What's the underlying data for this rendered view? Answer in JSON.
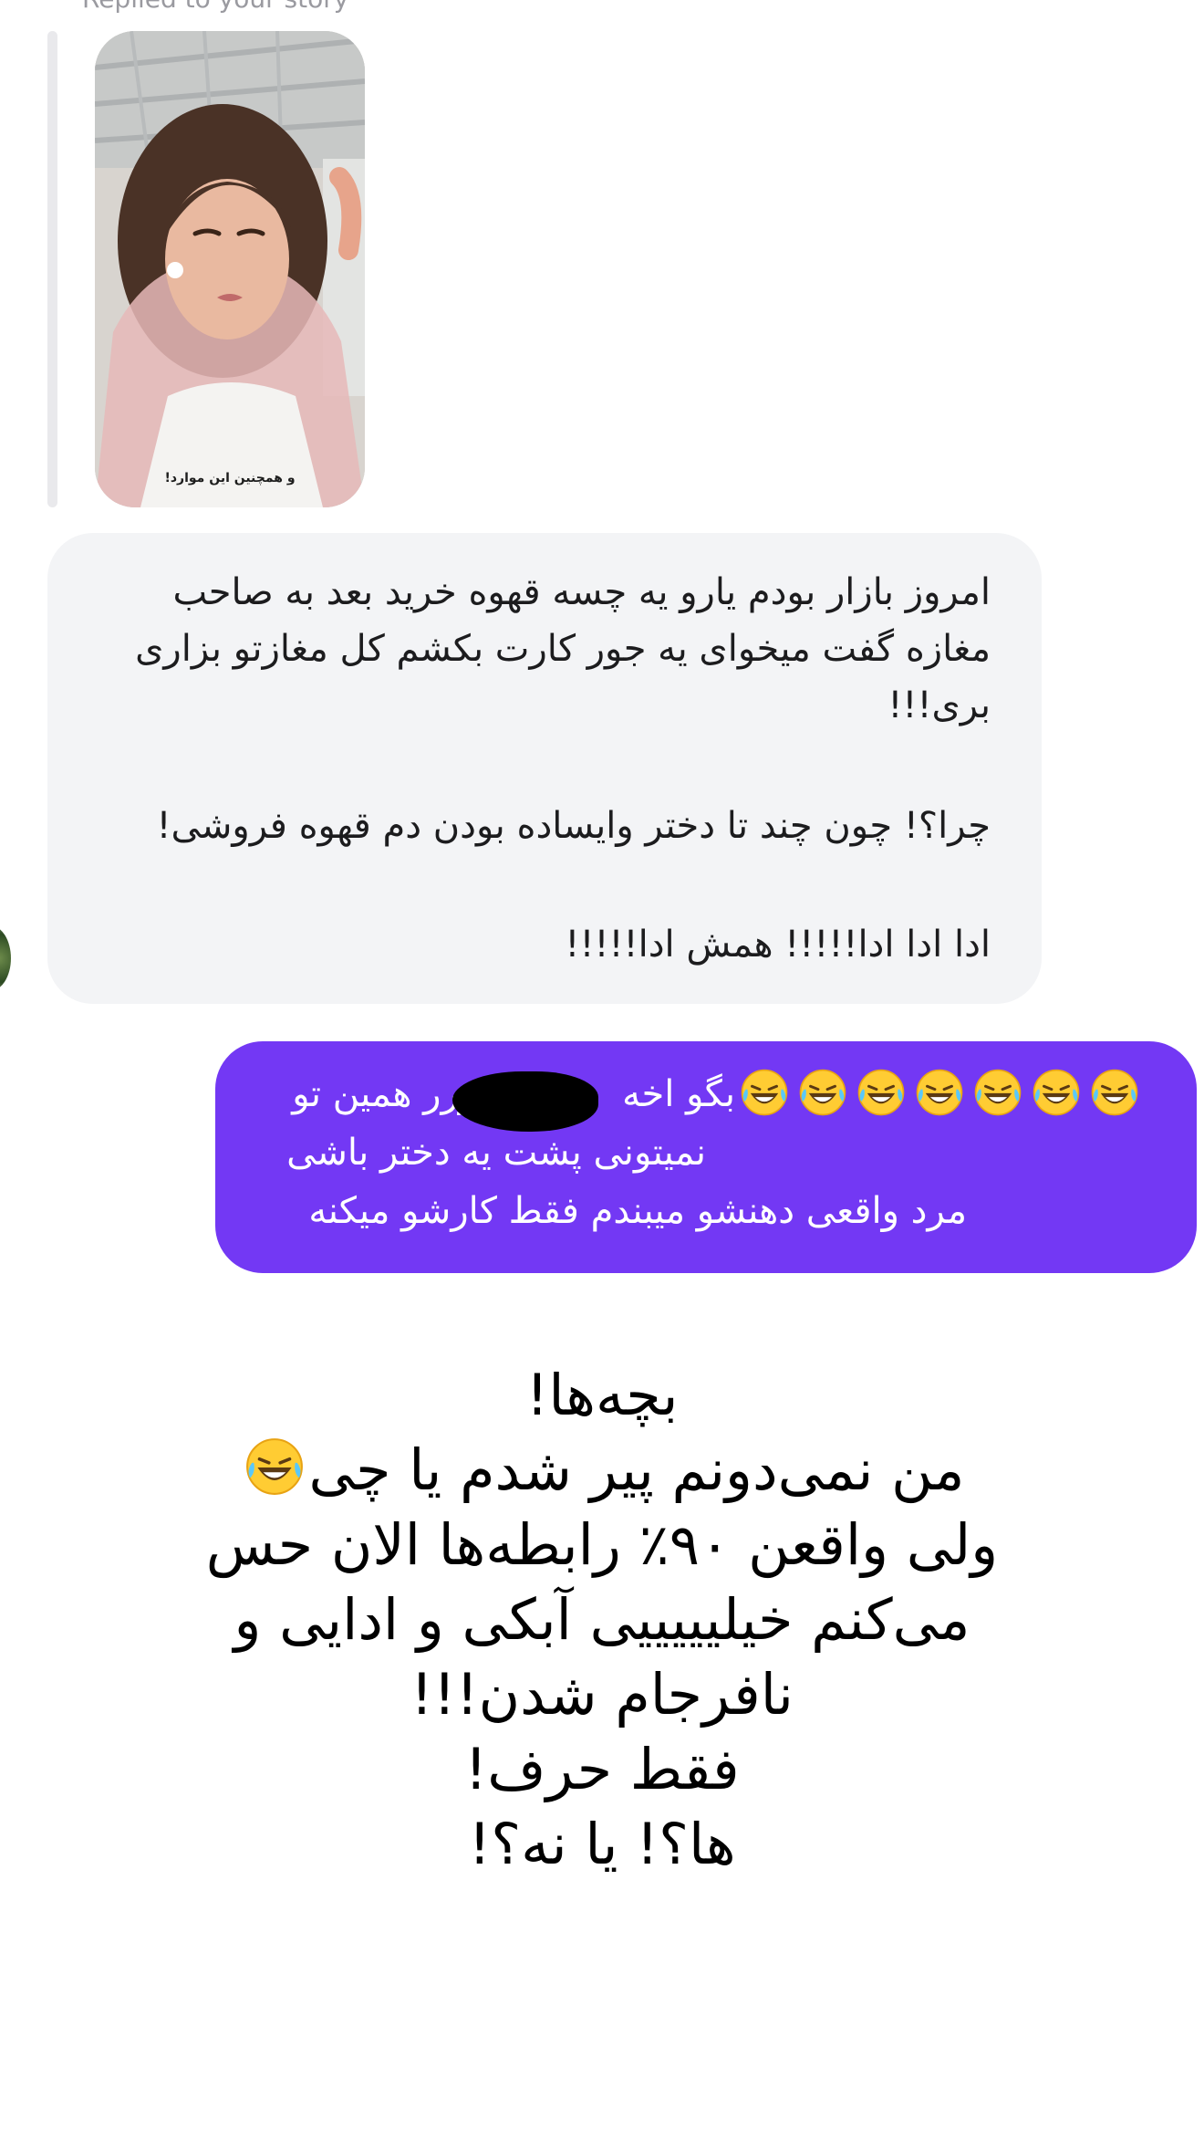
{
  "replied_label": "Replied to your story",
  "story": {
    "caption": "و همچنین این موارد!"
  },
  "incoming_message": {
    "lines": [
      "امروز بازار بودم یارو یه چسه قهوه خرید بعد به صاحب",
      "مغازه گفت میخوای یه جور کارت بکشم کل مغازتو بزاری",
      "بری!!!",
      "چرا؟! چون چند تا دختر وایساده بودن دم قهوه فروشی!",
      "ادا ادا ادا!!!!! همش ادا!!!!!"
    ]
  },
  "outgoing_message": {
    "emoji": "rolling-on-floor-laughing-emoji",
    "emoji_count": 7,
    "line1_text": "بگو اخه",
    "line1_tail": "ررر همین تو",
    "line2": "نمیتونی پشت یه دختر باشی",
    "line3": "مرد واقعی دهنشو میبندم فقط کارشو میکنه"
  },
  "caption": {
    "line1": "بچه‌ها!",
    "line2": "من نمی‌دونم پیر شدم یا چی",
    "line3": "ولی واقعن ۹۰٪ رابطه‌ها الان حس",
    "line4": "می‌کنم خیلیییییی آبکی و ادایی و",
    "line5": "نافرجام شدن!!!",
    "line6": "فقط حرف!",
    "line7": "ها؟! یا نه؟!"
  },
  "colors": {
    "incoming_bubble": "#f3f4f6",
    "outgoing_bubble": "#7338f4",
    "reply_bar": "#e9e9ec"
  }
}
